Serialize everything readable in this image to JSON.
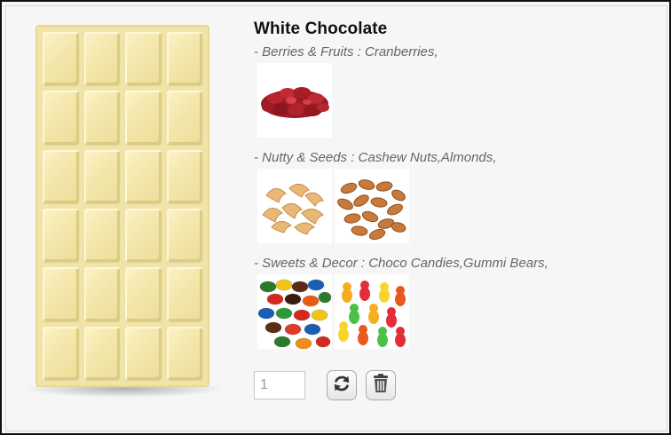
{
  "product": {
    "title": "White Chocolate"
  },
  "sections": [
    {
      "label": "- Berries & Fruits : Cranberries,",
      "items": [
        {
          "icon": "cranberries-image"
        }
      ]
    },
    {
      "label": "- Nutty & Seeds : Cashew Nuts,Almonds,",
      "items": [
        {
          "icon": "cashew-nuts-image"
        },
        {
          "icon": "almonds-image"
        }
      ]
    },
    {
      "label": "- Sweets & Decor : Choco Candies,Gummi Bears,",
      "items": [
        {
          "icon": "choco-candies-image"
        },
        {
          "icon": "gummi-bears-image"
        }
      ]
    }
  ],
  "cart": {
    "quantity": "1"
  },
  "colors": {
    "chocolate": "#f1e4a8",
    "label_text": "#666666"
  }
}
